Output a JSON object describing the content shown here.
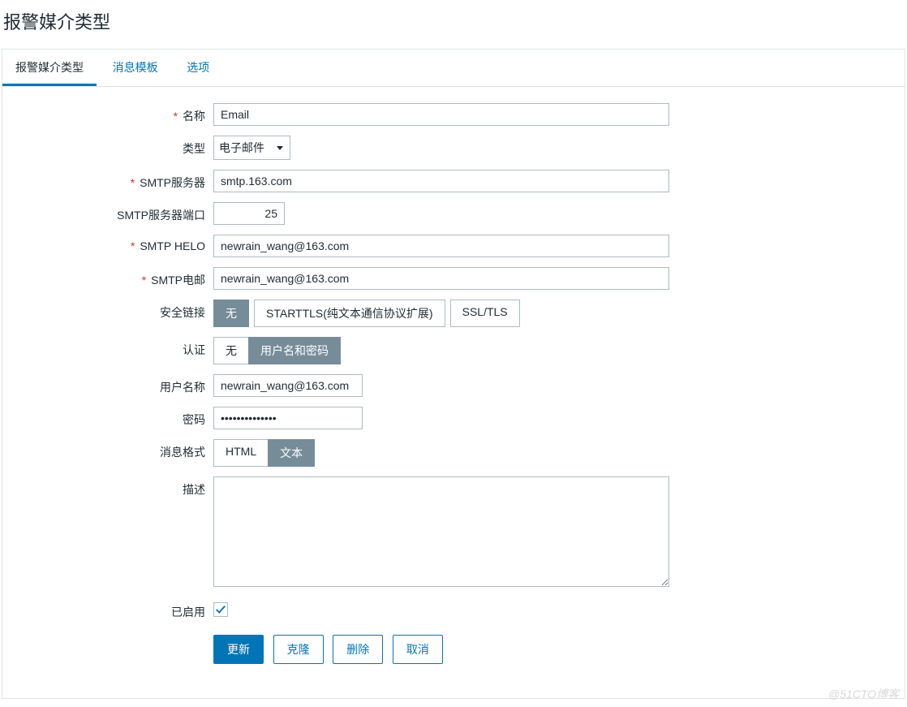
{
  "page": {
    "title": "报警媒介类型"
  },
  "tabs": [
    {
      "label": "报警媒介类型",
      "active": true
    },
    {
      "label": "消息模板",
      "active": false
    },
    {
      "label": "选项",
      "active": false
    }
  ],
  "form": {
    "name": {
      "label": "名称",
      "value": "Email",
      "required": true
    },
    "type": {
      "label": "类型",
      "value": "电子邮件"
    },
    "smtp_server": {
      "label": "SMTP服务器",
      "value": "smtp.163.com",
      "required": true
    },
    "smtp_port": {
      "label": "SMTP服务器端口",
      "value": "25"
    },
    "smtp_helo": {
      "label": "SMTP HELO",
      "value": "newrain_wang@163.com",
      "required": true
    },
    "smtp_email": {
      "label": "SMTP电邮",
      "value": "newrain_wang@163.com",
      "required": true
    },
    "security": {
      "label": "安全链接",
      "options": [
        "无",
        "STARTTLS(纯文本通信协议扩展)",
        "SSL/TLS"
      ],
      "selected": 0
    },
    "auth": {
      "label": "认证",
      "options": [
        "无",
        "用户名和密码"
      ],
      "selected": 1
    },
    "username": {
      "label": "用户名称",
      "value": "newrain_wang@163.com"
    },
    "password": {
      "label": "密码",
      "value": "••••••••••••••"
    },
    "format": {
      "label": "消息格式",
      "options": [
        "HTML",
        "文本"
      ],
      "selected": 1
    },
    "description": {
      "label": "描述",
      "value": ""
    },
    "enabled": {
      "label": "已启用",
      "checked": true
    }
  },
  "buttons": {
    "update": "更新",
    "clone": "克隆",
    "delete": "删除",
    "cancel": "取消"
  },
  "watermark": "@51CTO博客"
}
